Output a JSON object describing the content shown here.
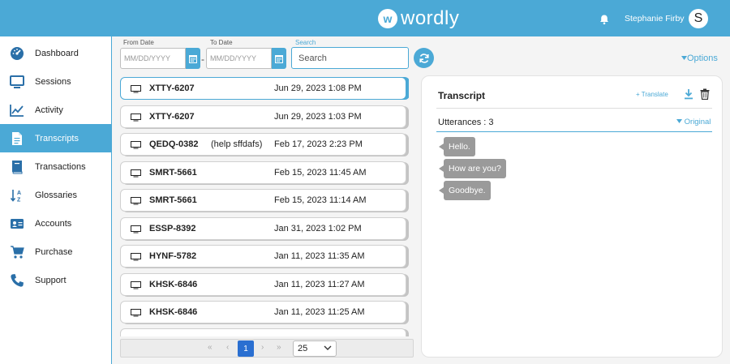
{
  "header": {
    "logo_letter": "w",
    "logo_text": "wordly",
    "user_name": "Stephanie Firby",
    "avatar_initial": "S"
  },
  "sidebar": {
    "items": [
      {
        "label": "Dashboard",
        "icon": "dashboard-icon"
      },
      {
        "label": "Sessions",
        "icon": "monitor-icon"
      },
      {
        "label": "Activity",
        "icon": "line-chart-icon"
      },
      {
        "label": "Transcripts",
        "icon": "document-icon",
        "active": true
      },
      {
        "label": "Transactions",
        "icon": "book-icon"
      },
      {
        "label": "Glossaries",
        "icon": "sort-az-icon"
      },
      {
        "label": "Accounts",
        "icon": "id-card-icon"
      },
      {
        "label": "Purchase",
        "icon": "cart-icon"
      },
      {
        "label": "Support",
        "icon": "phone-icon"
      }
    ]
  },
  "filters": {
    "from_label": "From Date",
    "to_label": "To Date",
    "search_label": "Search",
    "from_placeholder": "MM/DD/YYYY",
    "to_placeholder": "MM/DD/YYYY",
    "search_placeholder": "Search",
    "options_label": "Options"
  },
  "transcripts": [
    {
      "code": "XTTY-6207",
      "note": "",
      "date": "Jun 29, 2023 1:08 PM",
      "active": true
    },
    {
      "code": "XTTY-6207",
      "note": "",
      "date": "Jun 29, 2023 1:03 PM"
    },
    {
      "code": "QEDQ-0382",
      "note": "(help sffdafs)",
      "date": "Feb 17, 2023 2:23 PM"
    },
    {
      "code": "SMRT-5661",
      "note": "",
      "date": "Feb 15, 2023 11:45 AM"
    },
    {
      "code": "SMRT-5661",
      "note": "",
      "date": "Feb 15, 2023 11:14 AM"
    },
    {
      "code": "ESSP-8392",
      "note": "",
      "date": "Jan 31, 2023 1:02 PM"
    },
    {
      "code": "HYNF-5782",
      "note": "",
      "date": "Jan 11, 2023 11:35 AM"
    },
    {
      "code": "KHSK-6846",
      "note": "",
      "date": "Jan 11, 2023 11:27 AM"
    },
    {
      "code": "KHSK-6846",
      "note": "",
      "date": "Jan 11, 2023 11:25 AM"
    }
  ],
  "pagination": {
    "first": "«",
    "prev": "‹",
    "current_page": "1",
    "next": "›",
    "last": "»",
    "page_size": "25"
  },
  "panel": {
    "title": "Transcript",
    "translate_label": "+ Translate",
    "utterances_label": "Utterances :  3",
    "original_label": "Original",
    "utterances": [
      "Hello.",
      "How are you?",
      "Goodbye."
    ]
  },
  "colors": {
    "accent": "#4ba9d6",
    "page_active": "#2a6fd1",
    "bubble": "#9a9a9a"
  }
}
